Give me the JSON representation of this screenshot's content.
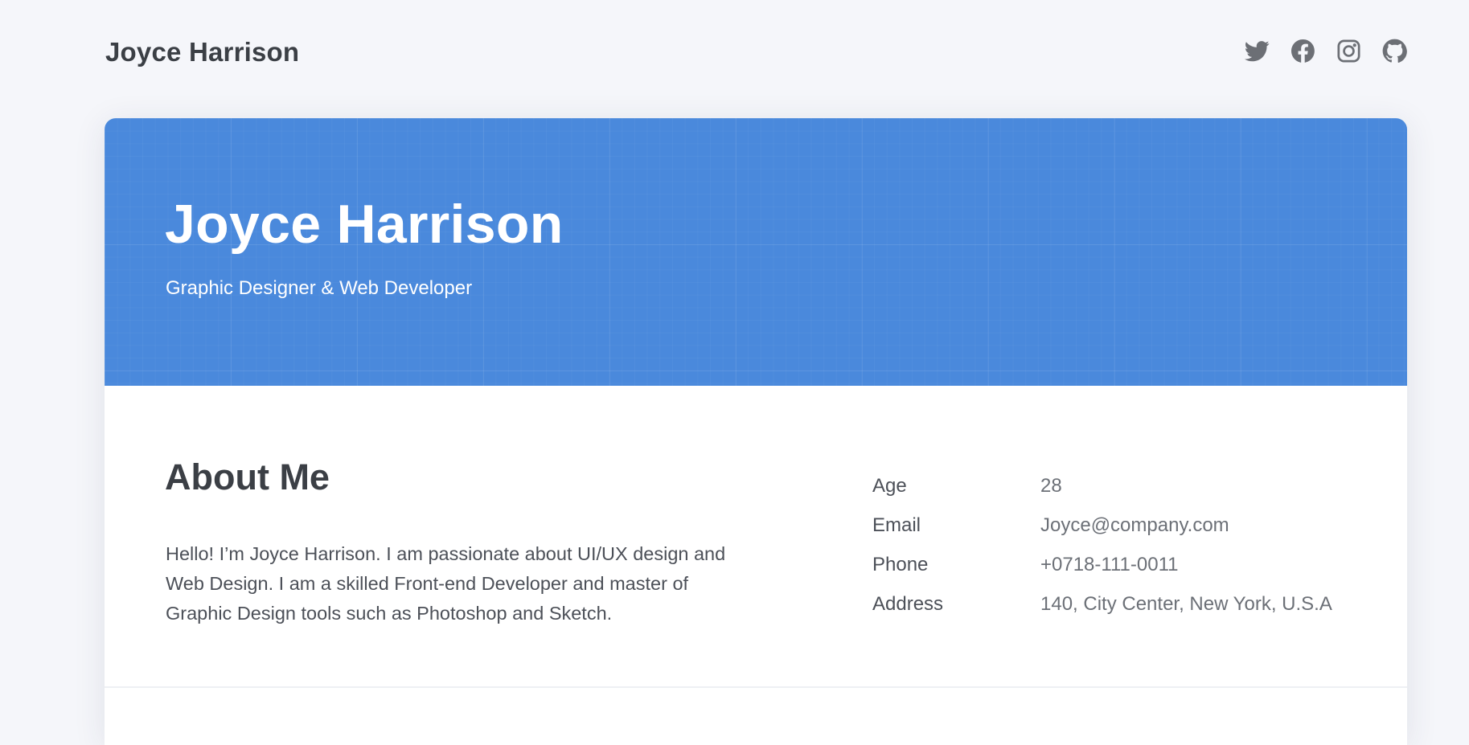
{
  "header": {
    "brand": "Joyce Harrison",
    "social": [
      {
        "icon": "twitter-icon",
        "label": "Twitter"
      },
      {
        "icon": "facebook-icon",
        "label": "Facebook"
      },
      {
        "icon": "instagram-icon",
        "label": "Instagram"
      },
      {
        "icon": "github-icon",
        "label": "GitHub"
      }
    ]
  },
  "hero": {
    "name": "Joyce Harrison",
    "role": "Graphic Designer & Web Developer",
    "background_color": "#4a89dc"
  },
  "about": {
    "title": "About Me",
    "text": "Hello! I’m Joyce Harrison. I am passionate about UI/UX design and Web Design. I am a skilled Front-end Developer and master of Graphic Design tools such as Photoshop and Sketch.",
    "info": [
      {
        "label": "Age",
        "value": "28"
      },
      {
        "label": "Email",
        "value": "Joyce@company.com"
      },
      {
        "label": "Phone",
        "value": "+0718-111-0011"
      },
      {
        "label": "Address",
        "value": "140, City Center, New York, U.S.A"
      }
    ]
  },
  "colors": {
    "page_background": "#f5f6fa",
    "text_dark": "#3b3f45",
    "text_muted": "#6c7077",
    "icon": "#6c6f75"
  }
}
